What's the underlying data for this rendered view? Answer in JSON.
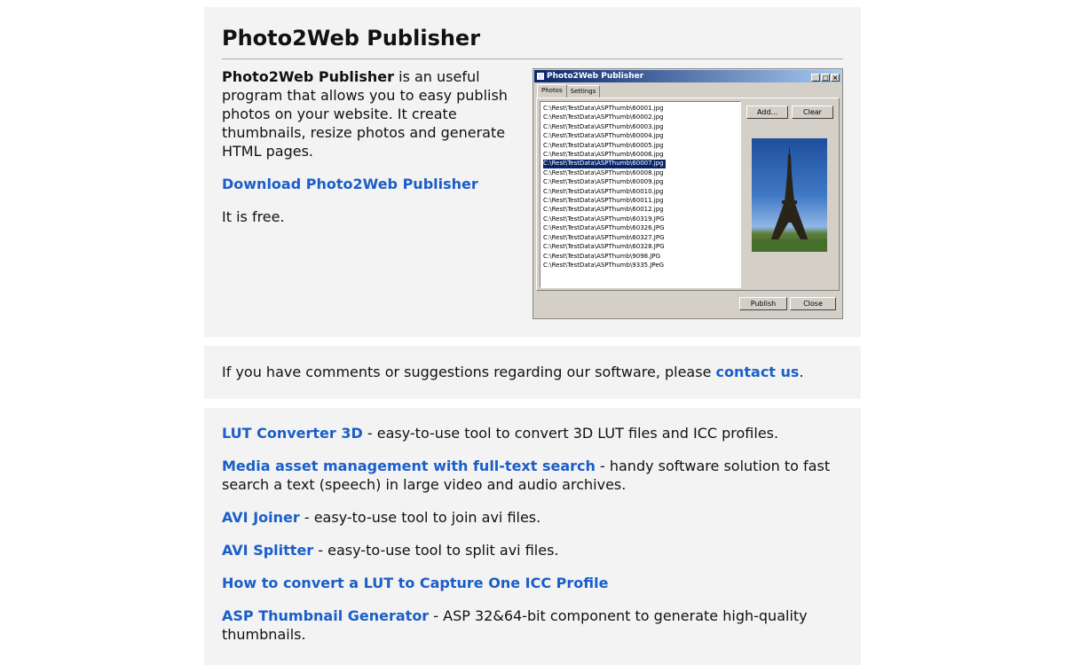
{
  "product": {
    "title": "Photo2Web Publisher",
    "intro_bold": "Photo2Web Publisher",
    "intro_rest": " is an useful program that allows you to easy publish photos on your website. It create thumbnails, resize photos and generate HTML pages.",
    "download_link": "Download Photo2Web Publisher",
    "free_note": "It is free."
  },
  "app_window": {
    "title": "Photo2Web Publisher",
    "tabs": [
      "Photos",
      "Settings"
    ],
    "files": [
      "C:\\Rest\\TestData\\ASPThumb\\60001.jpg",
      "C:\\Rest\\TestData\\ASPThumb\\60002.jpg",
      "C:\\Rest\\TestData\\ASPThumb\\60003.jpg",
      "C:\\Rest\\TestData\\ASPThumb\\60004.jpg",
      "C:\\Rest\\TestData\\ASPThumb\\60005.jpg",
      "C:\\Rest\\TestData\\ASPThumb\\60006.jpg",
      "C:\\Rest\\TestData\\ASPThumb\\60007.jpg",
      "C:\\Rest\\TestData\\ASPThumb\\60008.jpg",
      "C:\\Rest\\TestData\\ASPThumb\\60009.jpg",
      "C:\\Rest\\TestData\\ASPThumb\\60010.jpg",
      "C:\\Rest\\TestData\\ASPThumb\\60011.jpg",
      "C:\\Rest\\TestData\\ASPThumb\\60012.jpg",
      "C:\\Rest\\TestData\\ASPThumb\\60319.JPG",
      "C:\\Rest\\TestData\\ASPThumb\\60326.JPG",
      "C:\\Rest\\TestData\\ASPThumb\\60327.JPG",
      "C:\\Rest\\TestData\\ASPThumb\\60328.JPG",
      "C:\\Rest\\TestData\\ASPThumb\\9098.JPG",
      "C:\\Rest\\TestData\\ASPThumb\\9335.JPeG"
    ],
    "selected_file": "C:\\Rest\\TestData\\ASPThumb\\60007.jpg",
    "add_button": "Add...",
    "clear_button": "Clear",
    "publish_button": "Publish",
    "close_button": "Close"
  },
  "contact": {
    "text_before": "If you have comments or suggestions regarding our software, please ",
    "link": "contact us",
    "text_after": "."
  },
  "related": [
    {
      "link": "LUT Converter 3D",
      "desc": " - easy-to-use tool to convert 3D LUT files and ICC profiles."
    },
    {
      "link": "Media asset management with full-text search",
      "desc": " - handy software solution to fast search a text (speech) in large video and audio archives."
    },
    {
      "link": "AVI Joiner",
      "desc": " - easy-to-use tool to join avi files."
    },
    {
      "link": "AVI Splitter",
      "desc": " - easy-to-use tool to split avi files."
    },
    {
      "link": "How to convert a LUT to Capture One ICC Profile",
      "desc": ""
    },
    {
      "link": "ASP Thumbnail Generator",
      "desc": " - ASP 32&64-bit component to generate high-quality thumbnails."
    }
  ]
}
